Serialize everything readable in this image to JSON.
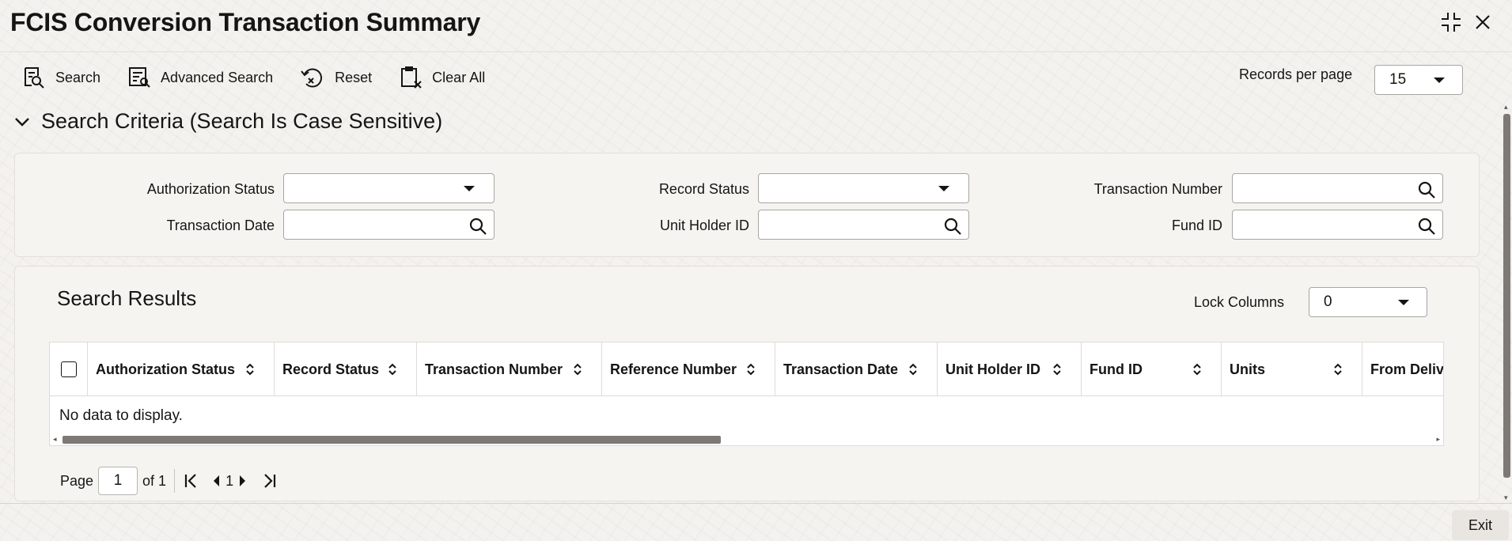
{
  "window": {
    "title": "FCIS Conversion Transaction Summary",
    "minimize_icon": "collapse-icon",
    "close_icon": "close-icon"
  },
  "toolbar": {
    "search_label": "Search",
    "advanced_search_label": "Advanced Search",
    "reset_label": "Reset",
    "clear_all_label": "Clear All",
    "records_per_page_label": "Records per page",
    "records_per_page_value": "15"
  },
  "criteria": {
    "title": "Search Criteria (Search Is Case Sensitive)",
    "fields": {
      "authorization_status": {
        "label": "Authorization Status",
        "value": ""
      },
      "record_status": {
        "label": "Record Status",
        "value": ""
      },
      "transaction_number": {
        "label": "Transaction Number",
        "value": ""
      },
      "transaction_date": {
        "label": "Transaction Date",
        "value": ""
      },
      "unit_holder_id": {
        "label": "Unit Holder ID",
        "value": ""
      },
      "fund_id": {
        "label": "Fund ID",
        "value": ""
      }
    }
  },
  "results": {
    "title": "Search Results",
    "lock_columns_label": "Lock Columns",
    "lock_columns_value": "0",
    "columns": [
      "Authorization Status",
      "Record Status",
      "Transaction Number",
      "Reference Number",
      "Transaction Date",
      "Unit Holder ID",
      "Fund ID",
      "Units",
      "From Delive"
    ],
    "empty_text": "No data to display."
  },
  "pager": {
    "page_label": "Page",
    "page_value": "1",
    "of_label": "of 1",
    "current_page": "1"
  },
  "footer": {
    "exit_label": "Exit"
  }
}
